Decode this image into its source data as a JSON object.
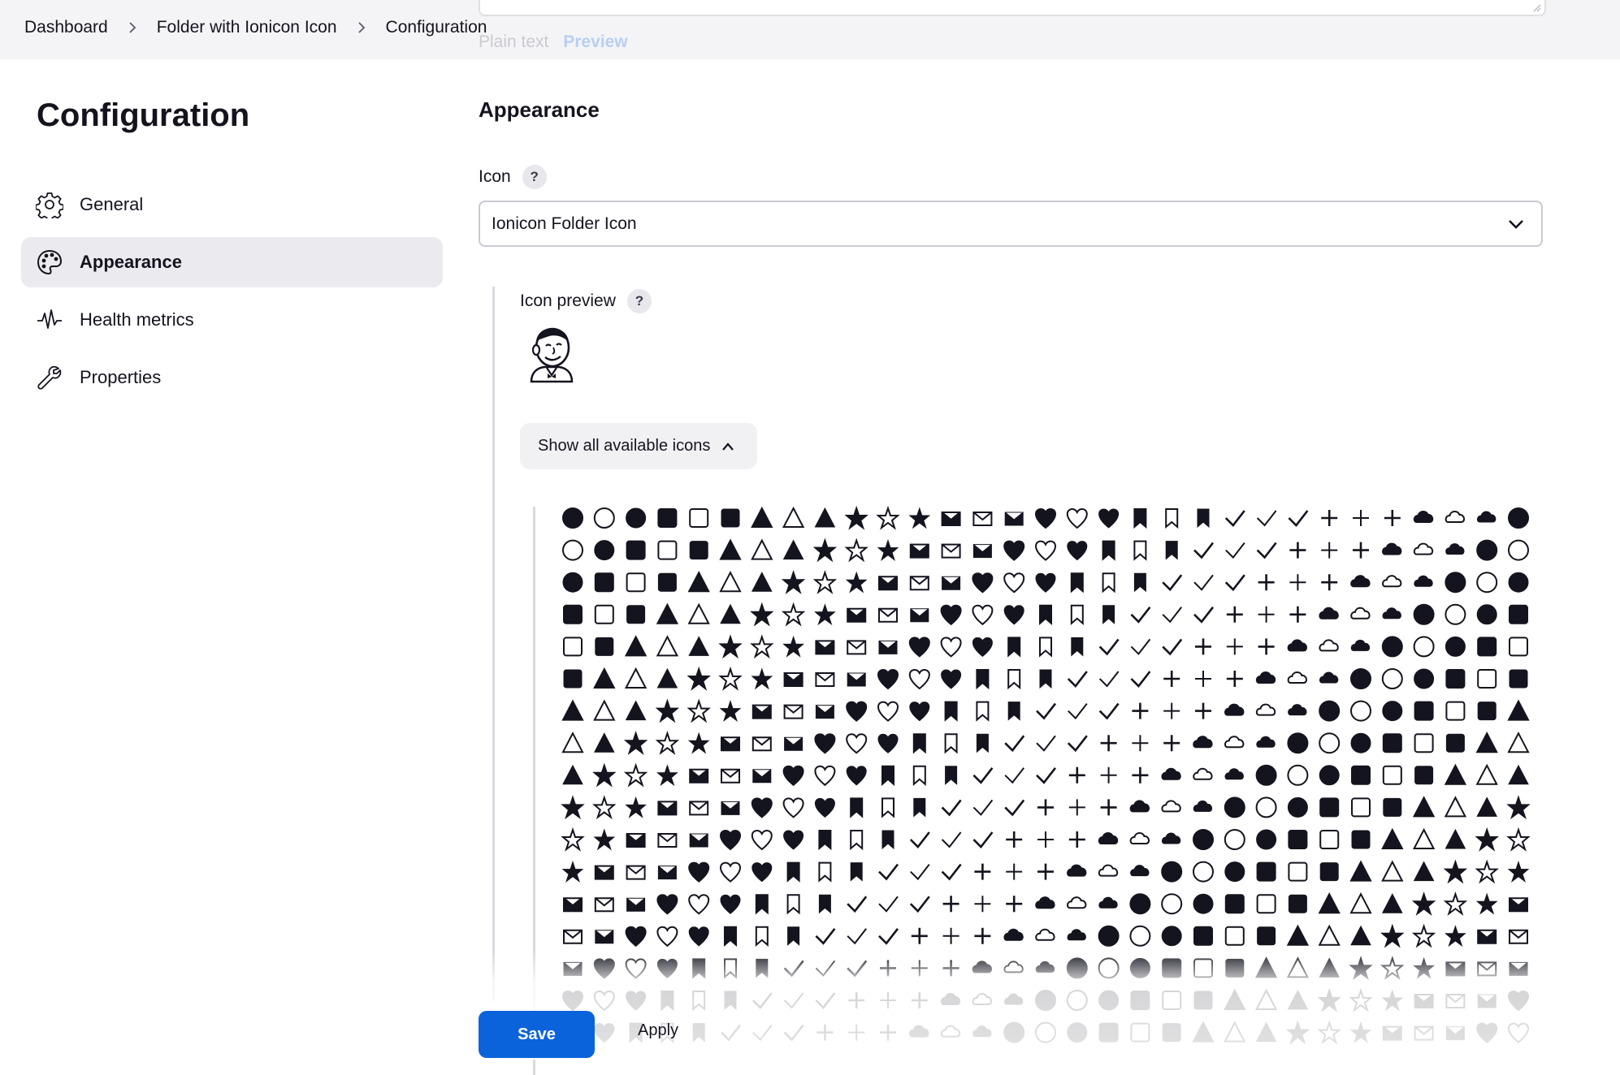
{
  "breadcrumb": {
    "items": [
      "Dashboard",
      "Folder with Ionicon Icon",
      "Configuration"
    ]
  },
  "description_toggle": {
    "plain_text": "Plain text",
    "preview": "Preview"
  },
  "sidebar": {
    "title": "Configuration",
    "items": [
      {
        "label": "General",
        "icon": "gear-icon",
        "active": false
      },
      {
        "label": "Appearance",
        "icon": "palette-icon",
        "active": true
      },
      {
        "label": "Health metrics",
        "icon": "pulse-icon",
        "active": false
      },
      {
        "label": "Properties",
        "icon": "wrench-icon",
        "active": false
      }
    ]
  },
  "main": {
    "section_title": "Appearance",
    "icon_field": {
      "label": "Icon",
      "help": "?",
      "selected": "Ionicon Folder Icon"
    },
    "icon_preview": {
      "label": "Icon preview",
      "help": "?",
      "image": "jenkins-butler-logo"
    },
    "show_icons_button": "Show all available icons",
    "icon_library": {
      "name": "Ionicons",
      "icon_style": "filled / outline / sharp variants"
    }
  },
  "actions": {
    "save": "Save",
    "apply": "Apply"
  },
  "colors": {
    "accent": "#0b63dc",
    "topbar_bg": "#f4f4f6",
    "active_nav_bg": "#ebebef",
    "text": "#14141f"
  }
}
